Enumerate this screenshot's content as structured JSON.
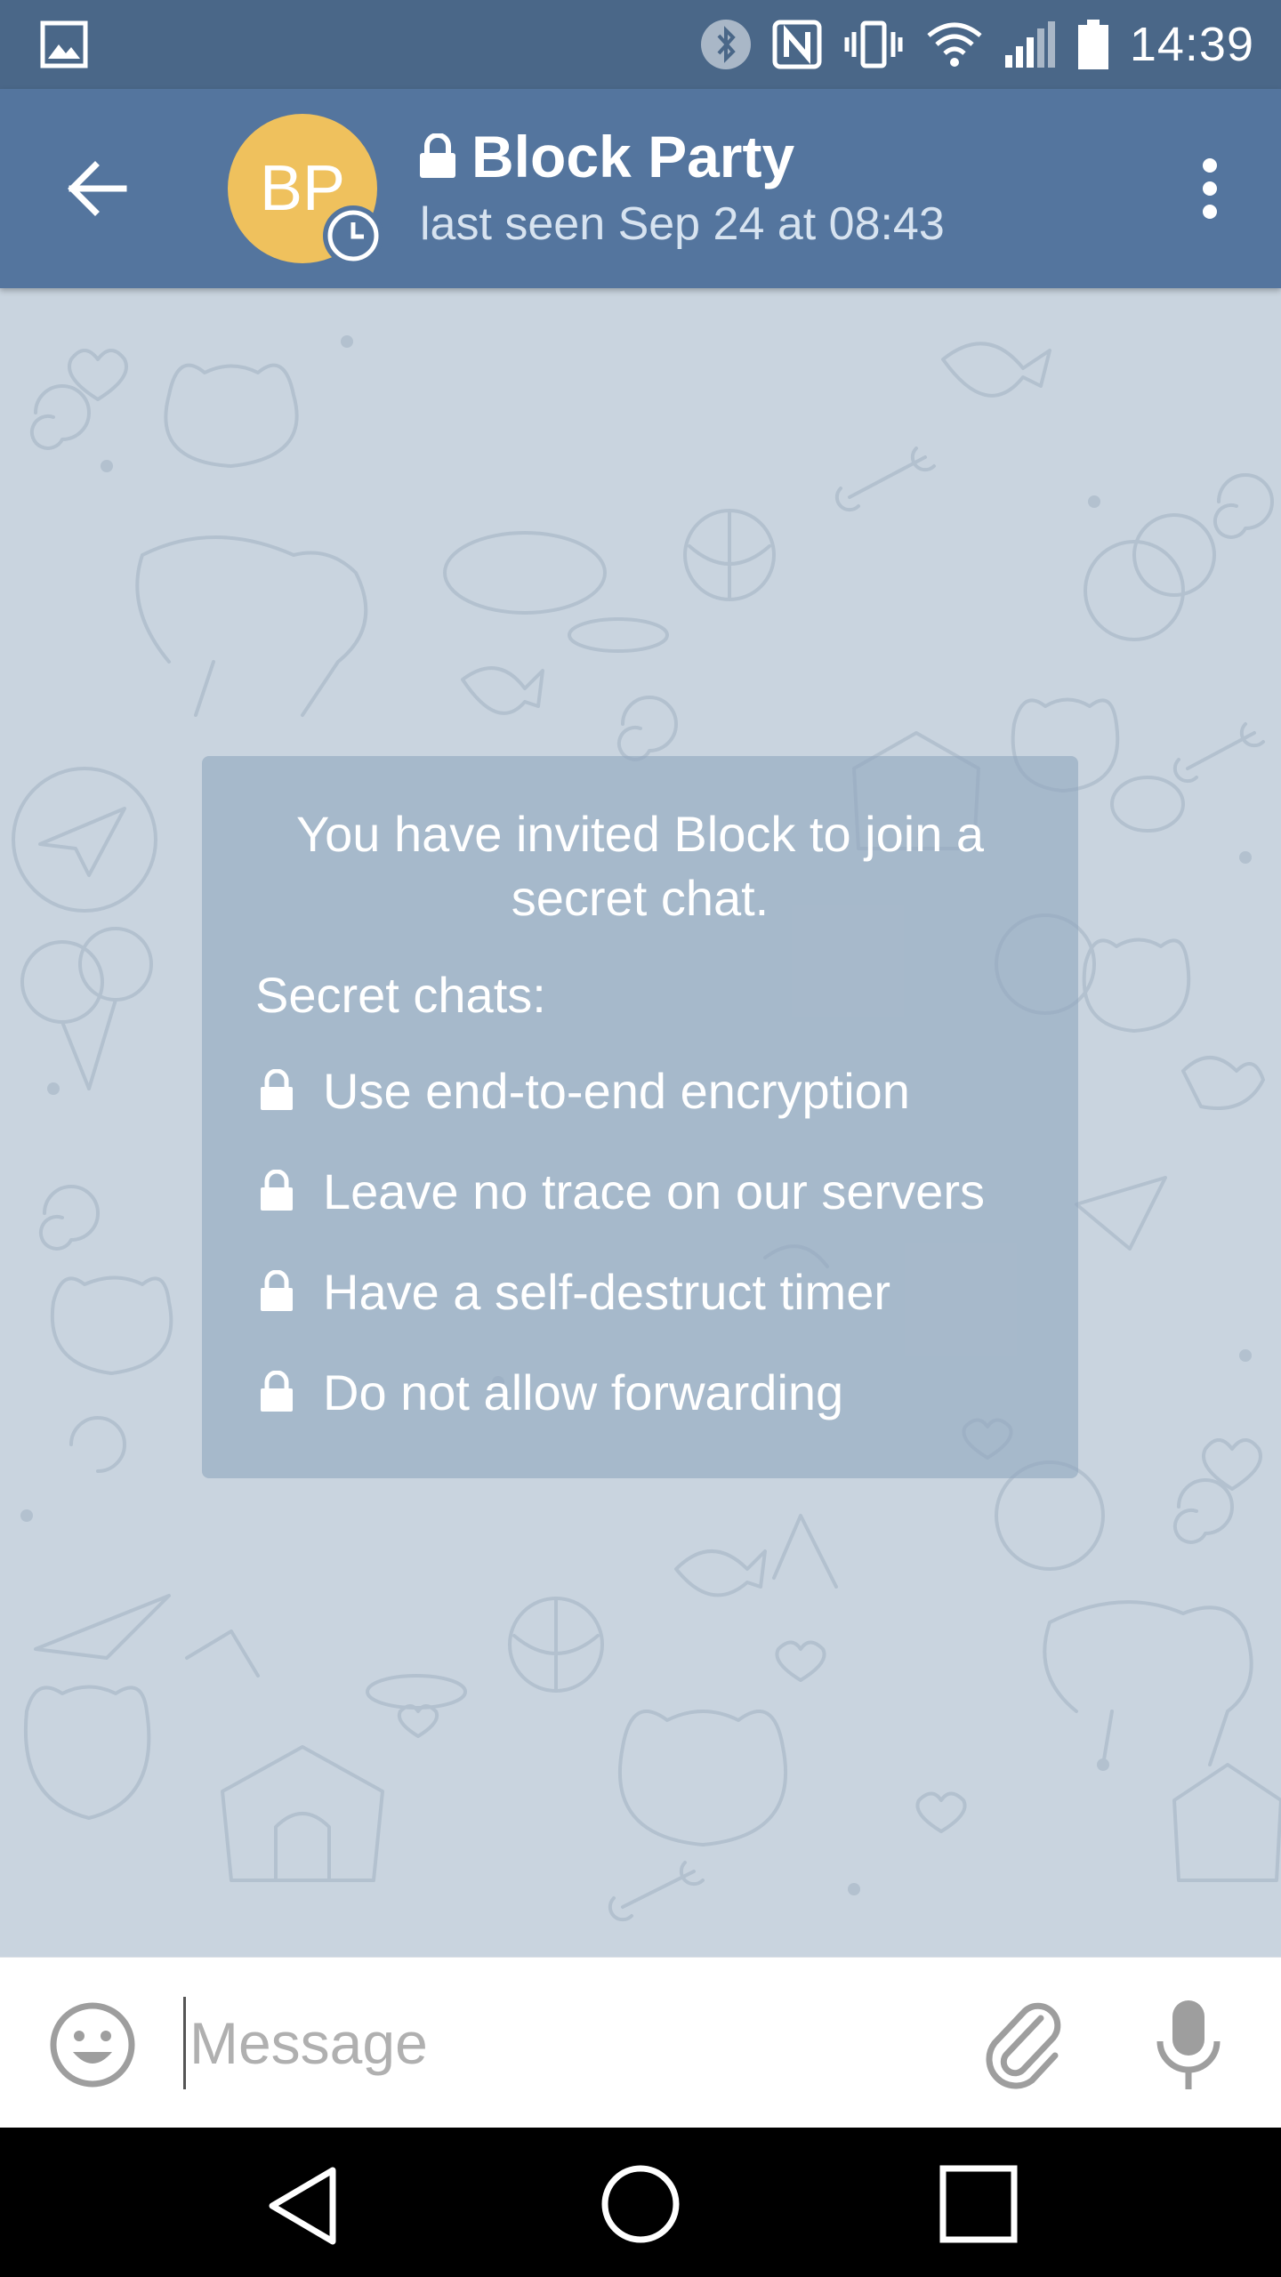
{
  "status_bar": {
    "time": "14:39",
    "icons": [
      "gallery-icon",
      "bluetooth-icon",
      "nfc-icon",
      "vibrate-icon",
      "wifi-icon",
      "signal-icon",
      "battery-icon"
    ]
  },
  "header": {
    "title": "Block Party",
    "subtitle": "last seen Sep 24 at 08:43",
    "avatar_initials": "BP",
    "avatar_color": "#efc15d",
    "header_color": "#54759e",
    "status_bar_color": "#4a6788"
  },
  "secret_chat_info": {
    "heading": "You have invited Block to join a secret chat.",
    "label": "Secret chats:",
    "features": [
      "Use end-to-end encryption",
      "Leave no trace on our servers",
      "Have a self-destruct timer",
      "Do not allow forwarding"
    ]
  },
  "input_bar": {
    "placeholder": "Message",
    "value": ""
  },
  "nav_bar": {
    "icons": [
      "nav-back-icon",
      "nav-home-icon",
      "nav-recents-icon"
    ]
  }
}
